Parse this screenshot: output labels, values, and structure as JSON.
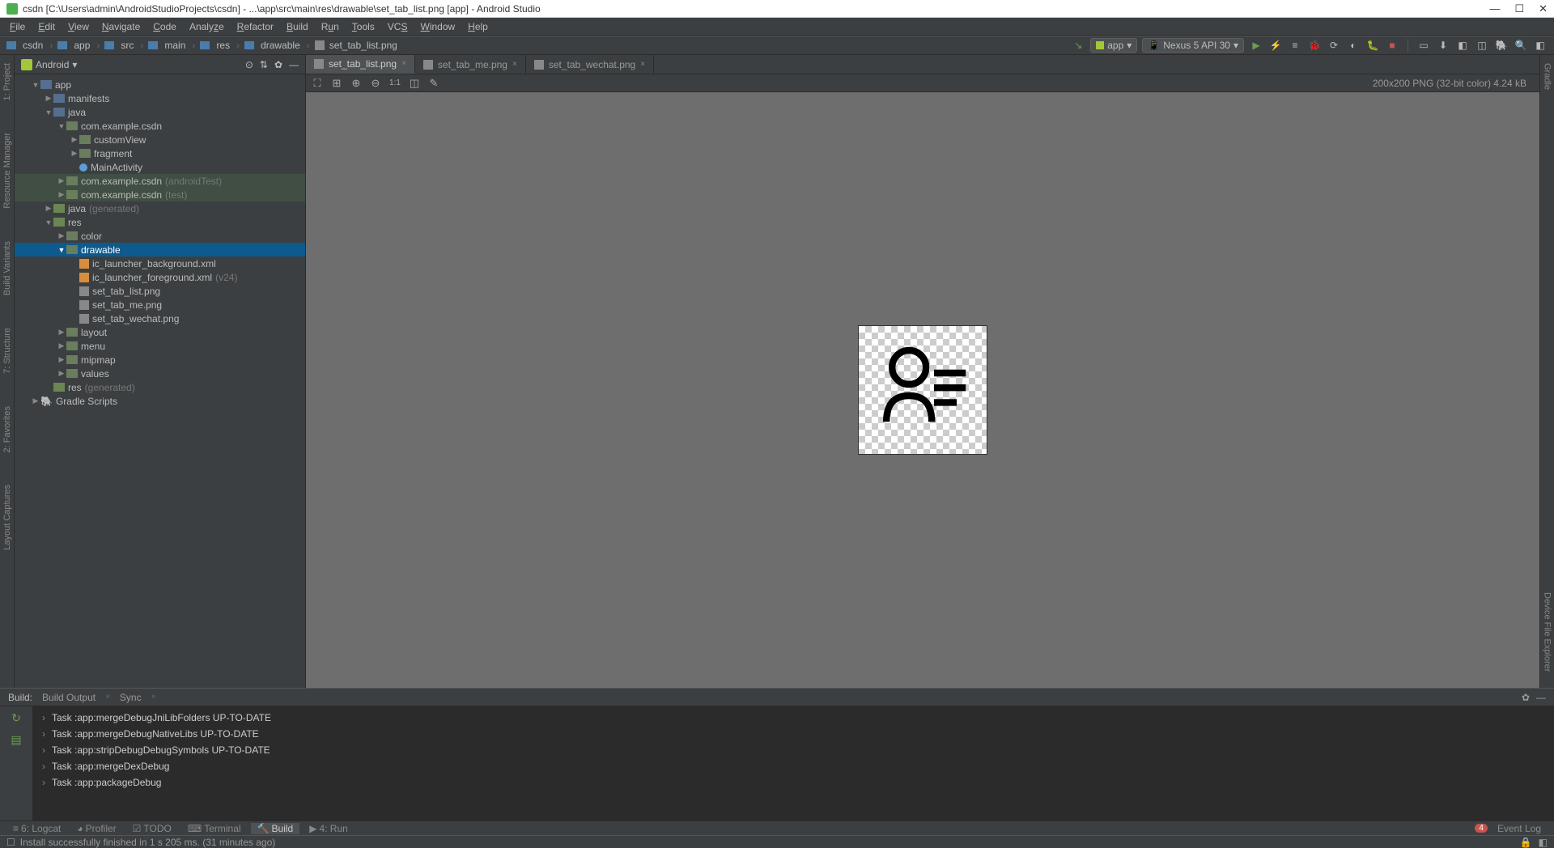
{
  "titleBar": {
    "title": "csdn [C:\\Users\\admin\\AndroidStudioProjects\\csdn] - ...\\app\\src\\main\\res\\drawable\\set_tab_list.png [app] - Android Studio"
  },
  "menuBar": {
    "items": [
      "File",
      "Edit",
      "View",
      "Navigate",
      "Code",
      "Analyze",
      "Refactor",
      "Build",
      "Run",
      "Tools",
      "VCS",
      "Window",
      "Help"
    ]
  },
  "breadcrumb": {
    "items": [
      "csdn",
      "app",
      "src",
      "main",
      "res",
      "drawable",
      "set_tab_list.png"
    ]
  },
  "runConfig": {
    "app": "app",
    "device": "Nexus 5 API 30"
  },
  "projectPanel": {
    "title": "Android"
  },
  "tree": {
    "app": "app",
    "manifests": "manifests",
    "java": "java",
    "pkg1": "com.example.csdn",
    "customView": "customView",
    "fragment": "fragment",
    "mainActivity": "MainActivity",
    "pkg2": "com.example.csdn",
    "pkg2_suffix": "(androidTest)",
    "pkg3": "com.example.csdn",
    "pkg3_suffix": "(test)",
    "javaGen": "java",
    "javaGen_suffix": "(generated)",
    "res": "res",
    "color": "color",
    "drawable": "drawable",
    "ic_bg": "ic_launcher_background.xml",
    "ic_fg": "ic_launcher_foreground.xml",
    "ic_fg_suffix": "(v24)",
    "set_list": "set_tab_list.png",
    "set_me": "set_tab_me.png",
    "set_wechat": "set_tab_wechat.png",
    "layout": "layout",
    "menu": "menu",
    "mipmap": "mipmap",
    "values": "values",
    "resGen": "res",
    "resGen_suffix": "(generated)",
    "gradle": "Gradle Scripts"
  },
  "editorTabs": {
    "tab1": "set_tab_list.png",
    "tab2": "set_tab_me.png",
    "tab3": "set_tab_wechat.png"
  },
  "imageInfo": "200x200 PNG (32-bit color) 4.24 kB",
  "buildPanel": {
    "title": "Build:",
    "tab1": "Build Output",
    "tab2": "Sync",
    "lines": [
      "Task :app:mergeDebugJniLibFolders UP-TO-DATE",
      "Task :app:mergeDebugNativeLibs UP-TO-DATE",
      "Task :app:stripDebugDebugSymbols UP-TO-DATE",
      "Task :app:mergeDexDebug",
      "Task :app:packageDebug"
    ]
  },
  "bottomTabs": {
    "logcat": "6: Logcat",
    "profiler": "Profiler",
    "todo": "TODO",
    "terminal": "Terminal",
    "build": "Build",
    "run": "4: Run",
    "eventLog": "Event Log",
    "errCount": "4"
  },
  "statusBar": {
    "text": "Install successfully finished in 1 s 205 ms. (31 minutes ago)"
  },
  "sidebarLeft": {
    "project": "1: Project",
    "resMgr": "Resource Manager",
    "buildVar": "Build Variants",
    "structure": "7: Structure",
    "favorites": "2: Favorites",
    "captures": "Layout Captures"
  },
  "sidebarRight": {
    "gradle": "Gradle",
    "deviceExplorer": "Device File Explorer"
  }
}
